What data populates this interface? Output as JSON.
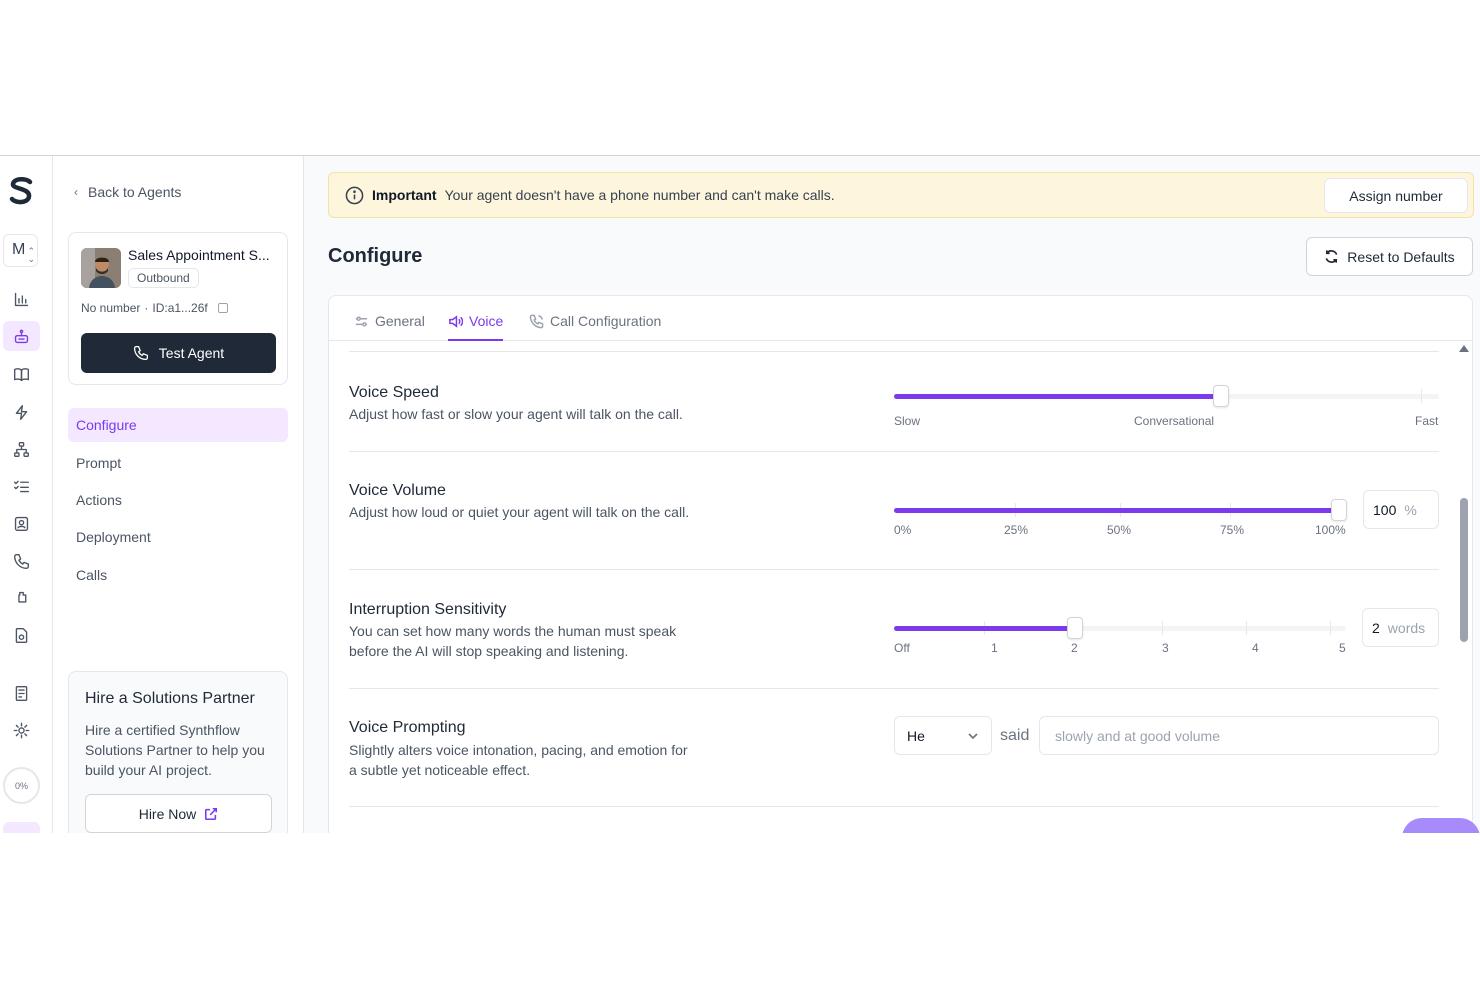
{
  "rail": {
    "workspace_initial": "M",
    "progress": "0%",
    "icons": [
      "analytics-icon",
      "agents-icon",
      "knowledge-base-icon",
      "actions-icon",
      "flows-icon",
      "tasks-icon",
      "contacts-icon",
      "phone-icon",
      "integrations-icon",
      "files-icon",
      "billing-icon",
      "settings-icon"
    ]
  },
  "sidebar": {
    "back_label": "Back to Agents",
    "agent": {
      "name": "Sales Appointment S...",
      "type": "Outbound",
      "number": "No number",
      "separator": "·",
      "id": "ID:a1...26f",
      "test_button": "Test Agent"
    },
    "nav": [
      {
        "label": "Configure",
        "active": true
      },
      {
        "label": "Prompt",
        "active": false
      },
      {
        "label": "Actions",
        "active": false
      },
      {
        "label": "Deployment",
        "active": false
      },
      {
        "label": "Calls",
        "active": false
      }
    ],
    "partner": {
      "title": "Hire a Solutions Partner",
      "description": "Hire a certified Synthflow Solutions Partner to help you build your AI project.",
      "button": "Hire Now"
    }
  },
  "banner": {
    "label": "Important",
    "message": "Your agent doesn't have a phone number and can't make calls.",
    "button": "Assign number"
  },
  "page": {
    "title": "Configure",
    "reset_button": "Reset to Defaults"
  },
  "tabs": [
    {
      "label": "General",
      "active": false
    },
    {
      "label": "Voice",
      "active": true
    },
    {
      "label": "Call Configuration",
      "active": false
    }
  ],
  "settings": {
    "voice_speed": {
      "title": "Voice Speed",
      "description": "Adjust how fast or slow your agent will talk on the call.",
      "value_fraction": 0.6,
      "labels": [
        "Slow",
        "Conversational",
        "Fast"
      ]
    },
    "voice_volume": {
      "title": "Voice Volume",
      "description": "Adjust how loud or quiet your agent will talk on the call.",
      "value": "100",
      "unit": "%",
      "value_fraction": 1.0,
      "labels": [
        "0%",
        "25%",
        "50%",
        "75%",
        "100%"
      ]
    },
    "interruption": {
      "title": "Interruption Sensitivity",
      "description": "You can set how many words the human must speak before the AI will stop speaking and listening.",
      "value": "2",
      "unit": "words",
      "value_fraction": 0.4,
      "labels": [
        "Off",
        "1",
        "2",
        "3",
        "4",
        "5"
      ]
    },
    "voice_prompting": {
      "title": "Voice Prompting",
      "description": "Slightly alters voice intonation, pacing, and emotion for a subtle yet noticeable effect.",
      "pronoun": "He",
      "said": "said",
      "placeholder": "slowly and at good volume"
    }
  },
  "colors": {
    "accent": "#7c3aed",
    "accent_light": "#f3e8ff",
    "banner_bg": "#fdf6dd",
    "dark_button": "#1f2937"
  }
}
